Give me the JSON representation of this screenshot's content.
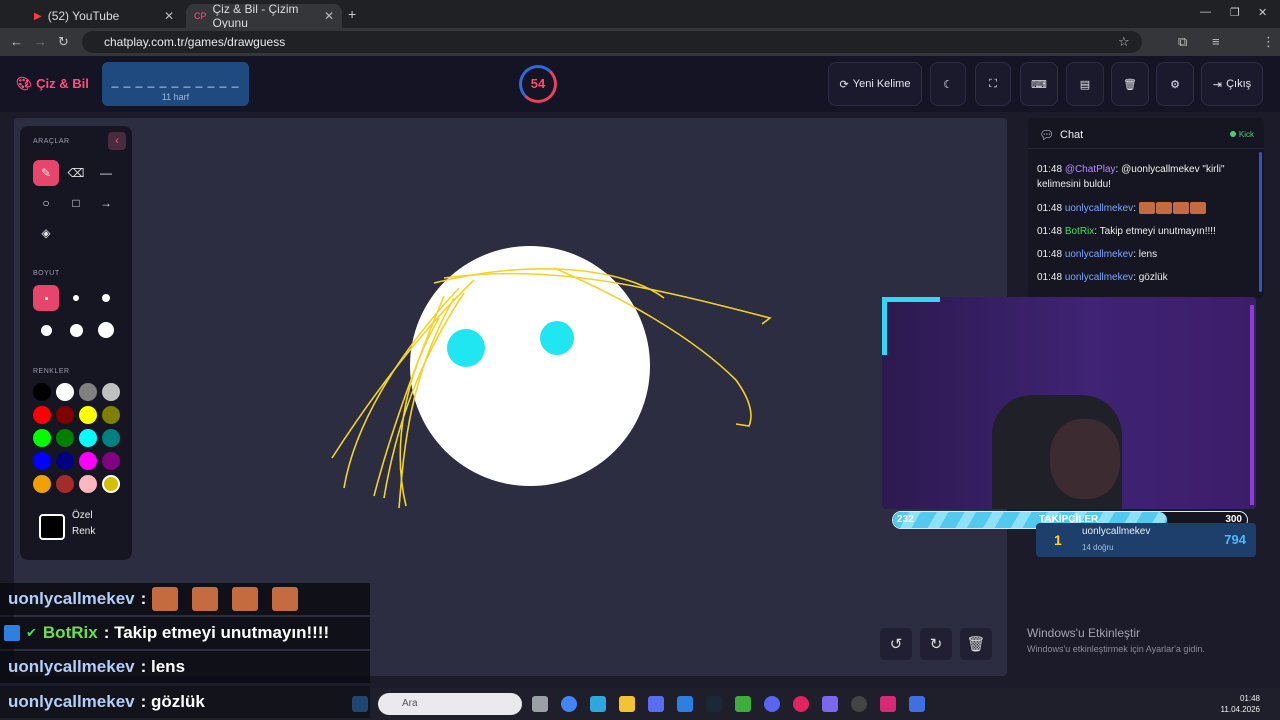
{
  "browser": {
    "tabs": [
      {
        "label": "(52) YouTube",
        "active": false
      },
      {
        "label": "Çiz & Bil - Çizim Oyunu",
        "active": true
      }
    ],
    "url": "chatplay.com.tr/games/drawguess"
  },
  "header": {
    "logo": "Çiz & Bil",
    "word_mask": "_ _ _ _ _ _ _ _ _ _ _",
    "word_length": "11 harf",
    "timer": "54",
    "buttons": {
      "new_word": "Yeni Kelime",
      "exit": "Çıkış"
    }
  },
  "tools": {
    "section_tools": "ARAÇLAR",
    "section_size": "BOYUT",
    "section_colors": "RENKLER",
    "custom_color_line1": "Özel",
    "custom_color_line2": "Renk",
    "colors": [
      "#000000",
      "#ffffff",
      "#808080",
      "#c0c0c0",
      "#ff0000",
      "#800000",
      "#ffff00",
      "#808000",
      "#00ff00",
      "#008000",
      "#00ffff",
      "#008080",
      "#0000ff",
      "#000080",
      "#ff00ff",
      "#800080",
      "#f0a000",
      "#a52a2a",
      "#ffb6c1",
      "#d4c000"
    ]
  },
  "chat": {
    "title": "Chat",
    "platform": "Kick",
    "messages": [
      {
        "time": "01:48",
        "user": "@ChatPlay",
        "text": ": @uonlycallmekev \"kirli\" kelimesini buldu!"
      },
      {
        "time": "01:48",
        "user": "uonlycallmekev",
        "text": ":"
      },
      {
        "time": "01:48",
        "user": "BotRix",
        "text": ": Takip etmeyi unutmayın!!!!"
      },
      {
        "time": "01:48",
        "user": "uonlycallmekev",
        "text": ": lens"
      },
      {
        "time": "01:48",
        "user": "uonlycallmekev",
        "text": ": gözlük"
      }
    ]
  },
  "followers": {
    "label": "TAKİPÇİLER",
    "current": "232",
    "goal": "300",
    "progress": 0.773
  },
  "leaderboard": {
    "rank": "1",
    "name": "uonlycallmekev",
    "sub": "14 doğru",
    "score": "794"
  },
  "windows_watermark": {
    "title": "Windows'u Etkinleştir",
    "subtitle": "Windows'u etkinleştirmek için Ayarlar'a gidin."
  },
  "overlay_chat": [
    {
      "user": "uonlycallmekev",
      "text": ":"
    },
    {
      "user": "BotRix",
      "text": ": Takip etmeyi unutmayın!!!!"
    },
    {
      "user": "uonlycallmekev",
      "text": ": lens"
    },
    {
      "user": "uonlycallmekev",
      "text": ": gözlük"
    }
  ],
  "taskbar": {
    "search_placeholder": "Ara",
    "time": "01:48",
    "date": "11.04.2026"
  }
}
